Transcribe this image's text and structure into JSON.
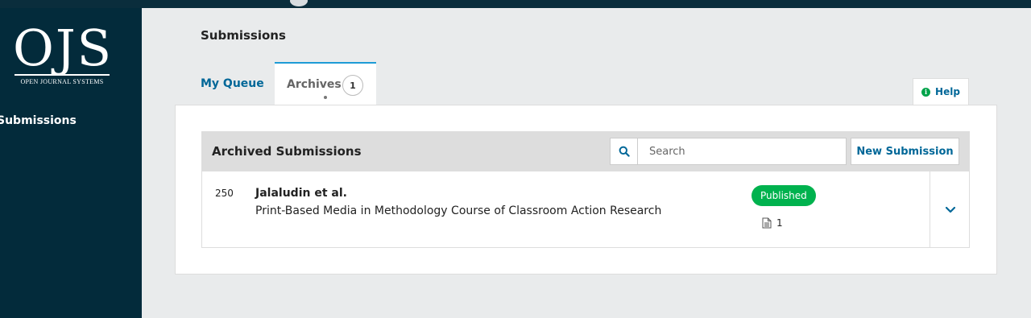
{
  "app": {
    "logo_text": "OJS",
    "logo_subtitle": "OPEN JOURNAL SYSTEMS"
  },
  "sidebar": {
    "items": [
      {
        "label": "Submissions"
      }
    ]
  },
  "page": {
    "title": "Submissions"
  },
  "tabs": [
    {
      "label": "My Queue"
    },
    {
      "label": "Archives",
      "count": "1"
    }
  ],
  "help": {
    "label": "Help",
    "icon": "info-icon"
  },
  "list": {
    "title": "Archived Submissions",
    "search_placeholder": "Search",
    "search_value": "",
    "new_submission_label": "New Submission",
    "items": [
      {
        "id": "250",
        "author": "Jalaludin et al.",
        "title": "Print-Based Media in Methodology Course of Classroom Action Research",
        "status": "Published",
        "files": "1"
      }
    ]
  },
  "colors": {
    "sidebar_bg": "#032b3b",
    "link": "#006798",
    "published_badge": "#00b24e",
    "tab_accent": "#1e9bd6"
  }
}
